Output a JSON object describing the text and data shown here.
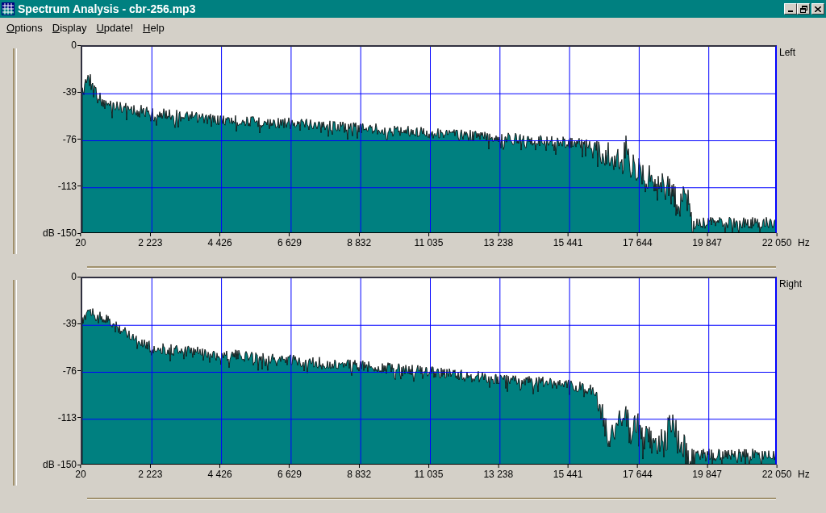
{
  "window": {
    "title": "Spectrum Analysis - cbr-256.mp3"
  },
  "menu": [
    "Options",
    "Display",
    "Update!",
    "Help"
  ],
  "channels": [
    {
      "name": "Left",
      "y_ticks": [
        "0",
        "-39",
        "-76",
        "-113",
        "dB -150"
      ],
      "x_ticks": [
        "20",
        "2 223",
        "4 426",
        "6 629",
        "8 832",
        "11 035",
        "13 238",
        "15 441",
        "17 644",
        "19 847",
        "22 050"
      ],
      "x_unit": "Hz"
    },
    {
      "name": "Right",
      "y_ticks": [
        "0",
        "-39",
        "-76",
        "-113",
        "dB -150"
      ],
      "x_ticks": [
        "20",
        "2 223",
        "4 426",
        "6 629",
        "8 832",
        "11 035",
        "13 238",
        "15 441",
        "17 644",
        "19 847",
        "22 050"
      ],
      "x_unit": "Hz"
    }
  ]
}
